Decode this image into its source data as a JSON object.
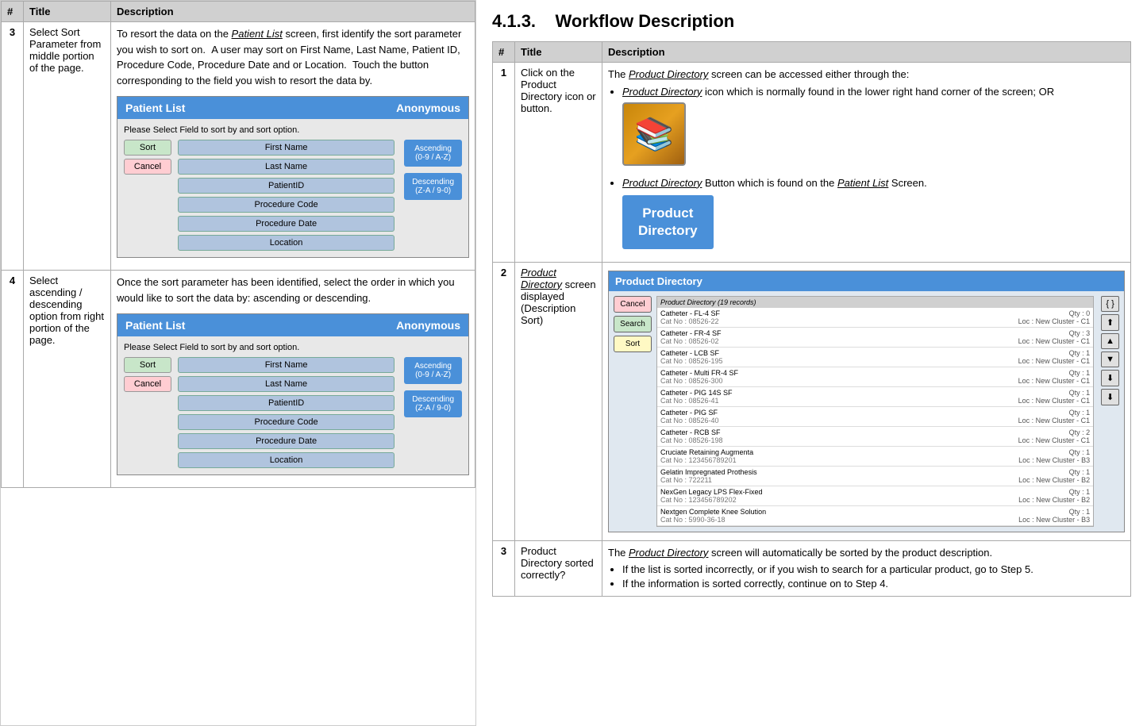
{
  "left_panel": {
    "table": {
      "headers": [
        "#",
        "Title",
        "Description"
      ],
      "rows": [
        {
          "num": "3",
          "title": "Select Sort Parameter from middle portion of the page.",
          "description": "To resort the data on the Patient List screen, first identify the sort parameter you wish to sort on.  A user may sort on First Name, Last Name, Patient ID, Procedure Code, Procedure Date and or Location.  Touch the button corresponding to the field you wish to resort the data by.",
          "patient_list_1": {
            "title": "Patient List",
            "anonymous": "Anonymous",
            "instruction": "Please Select Field to sort by and sort option.",
            "sort_btn": "Sort",
            "cancel_btn": "Cancel",
            "fields": [
              "First Name",
              "Last Name",
              "PatientID",
              "Procedure Code",
              "Procedure Date",
              "Location"
            ],
            "ascending_btn": "Ascending\n(0-9 / A-Z)",
            "descending_btn": "Descending\n(Z-A / 9-0)"
          }
        },
        {
          "num": "4",
          "title": "Select ascending / descending option from right portion of the page.",
          "description": "Once the sort parameter has been identified, select the order in which you would like to sort the data by: ascending or descending.",
          "patient_list_2": {
            "title": "Patient List",
            "anonymous": "Anonymous",
            "instruction": "Please Select Field to sort by and sort option.",
            "sort_btn": "Sort",
            "cancel_btn": "Cancel",
            "fields": [
              "First Name",
              "Last Name",
              "PatientID",
              "Procedure Code",
              "Procedure Date",
              "Location"
            ],
            "ascending_btn": "Ascending\n(0-9 / A-Z)",
            "descending_btn": "Descending\n(Z-A / 9-0)"
          }
        }
      ]
    }
  },
  "right_panel": {
    "section_number": "4.1.3.",
    "section_title": "Workflow Description",
    "table": {
      "headers": [
        "#",
        "Title",
        "Description"
      ],
      "rows": [
        {
          "num": "1",
          "title": "Click on the Product Directory icon or button.",
          "description_intro": "The Product Directory screen can be accessed either through the:",
          "bullets": [
            "Product Directory icon which is normally found in the lower right hand corner of the screen; OR",
            "Product Directory Button which is found on the Patient List Screen."
          ],
          "prod_dir_button_label": "Product\nDirectory"
        },
        {
          "num": "2",
          "title": "Product Directory screen displayed (Description Sort)",
          "pd_header": "Product Directory",
          "pd_record_count": "Product Directory (19 records)",
          "pd_cancel": "Cancel",
          "pd_search": "Search",
          "pd_sort": "Sort",
          "pd_items": [
            {
              "name": "Catheter - FL-4 SF",
              "cat": "Cat No : 08526-22",
              "qty": "Qty : 0",
              "loc": "Loc : New Cluster - C1"
            },
            {
              "name": "Catheter - FR-4 SF",
              "cat": "Cat No : 08526-02",
              "qty": "Qty : 3",
              "loc": "Loc : New Cluster - C1"
            },
            {
              "name": "Catheter - LCB SF",
              "cat": "Cat No : 08526-195",
              "qty": "Qty : 1",
              "loc": "Loc : New Cluster - C1"
            },
            {
              "name": "Catheter - Multi FR-4 SF",
              "cat": "Cat No : 08526-300",
              "qty": "Qty : 1",
              "loc": "Loc : New Cluster - C1"
            },
            {
              "name": "Catheter - PIG 14S SF",
              "cat": "Cat No : 08526-41",
              "qty": "Qty : 1",
              "loc": "Loc : New Cluster - C1"
            },
            {
              "name": "Catheter - PIG SF",
              "cat": "Cat No : 08526-40",
              "qty": "Qty : 1",
              "loc": "Loc : New Cluster - C1"
            },
            {
              "name": "Catheter - RCB SF",
              "cat": "Cat No : 08526-198",
              "qty": "Qty : 2",
              "loc": "Loc : New Cluster - C1"
            },
            {
              "name": "Cruciate Retaining Augmenta",
              "cat": "Cat No : 123456789201",
              "qty": "Qty : 1",
              "loc": "Loc : New Cluster - B3"
            },
            {
              "name": "Gelatin Impregnated Prothesis",
              "cat": "Cat No : 722211",
              "qty": "Qty : 1",
              "loc": "Loc : New Cluster - B2"
            },
            {
              "name": "NexGen Legacy LPS Flex-Fixed",
              "cat": "Cat No : 123456789202",
              "qty": "Qty : 1",
              "loc": "Loc : New Cluster - B2"
            },
            {
              "name": "Nextgen Complete Knee Solution",
              "cat": "Cat No : 5990-36-18",
              "qty": "Qty : 1",
              "loc": "Loc : New Cluster - B3"
            }
          ]
        },
        {
          "num": "3",
          "title": "Product Directory sorted correctly?",
          "description_intro": "The Product Directory screen will automatically be sorted by the product description.",
          "bullets": [
            "If the list is sorted incorrectly, or if you wish to search for a particular product, go to Step 5.",
            "If the information is sorted correctly, continue on to Step 4."
          ]
        }
      ]
    }
  },
  "colors": {
    "blue_header": "#4a90d9",
    "table_header_bg": "#d0d0d0",
    "sort_btn_bg": "#c8e6c9",
    "cancel_btn_bg": "#ffcdd2",
    "field_bg": "#b0c4de",
    "ascending_btn_bg": "#4a90d9",
    "descending_btn_bg": "#4a90d9"
  }
}
